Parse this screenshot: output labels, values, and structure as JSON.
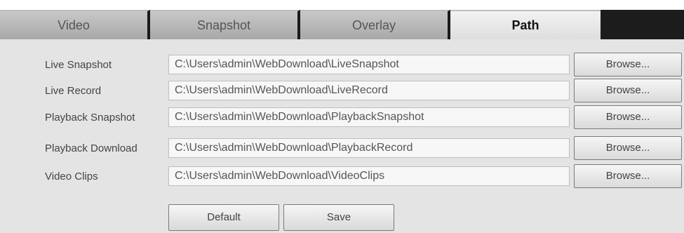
{
  "tabs": [
    {
      "label": "Video"
    },
    {
      "label": "Snapshot"
    },
    {
      "label": "Overlay"
    },
    {
      "label": "Path"
    }
  ],
  "active_tab": "Path",
  "rows": [
    {
      "label": "Live Snapshot",
      "value": "C:\\Users\\admin\\WebDownload\\LiveSnapshot",
      "button": "Browse..."
    },
    {
      "label": "Live Record",
      "value": "C:\\Users\\admin\\WebDownload\\LiveRecord",
      "button": "Browse..."
    },
    {
      "label": "Playback Snapshot",
      "value": "C:\\Users\\admin\\WebDownload\\PlaybackSnapshot",
      "button": "Browse..."
    },
    {
      "label": "Playback Download",
      "value": "C:\\Users\\admin\\WebDownload\\PlaybackRecord",
      "button": "Browse..."
    },
    {
      "label": "Video Clips",
      "value": "C:\\Users\\admin\\WebDownload\\VideoClips",
      "button": "Browse..."
    }
  ],
  "footer": {
    "default_label": "Default",
    "save_label": "Save"
  }
}
